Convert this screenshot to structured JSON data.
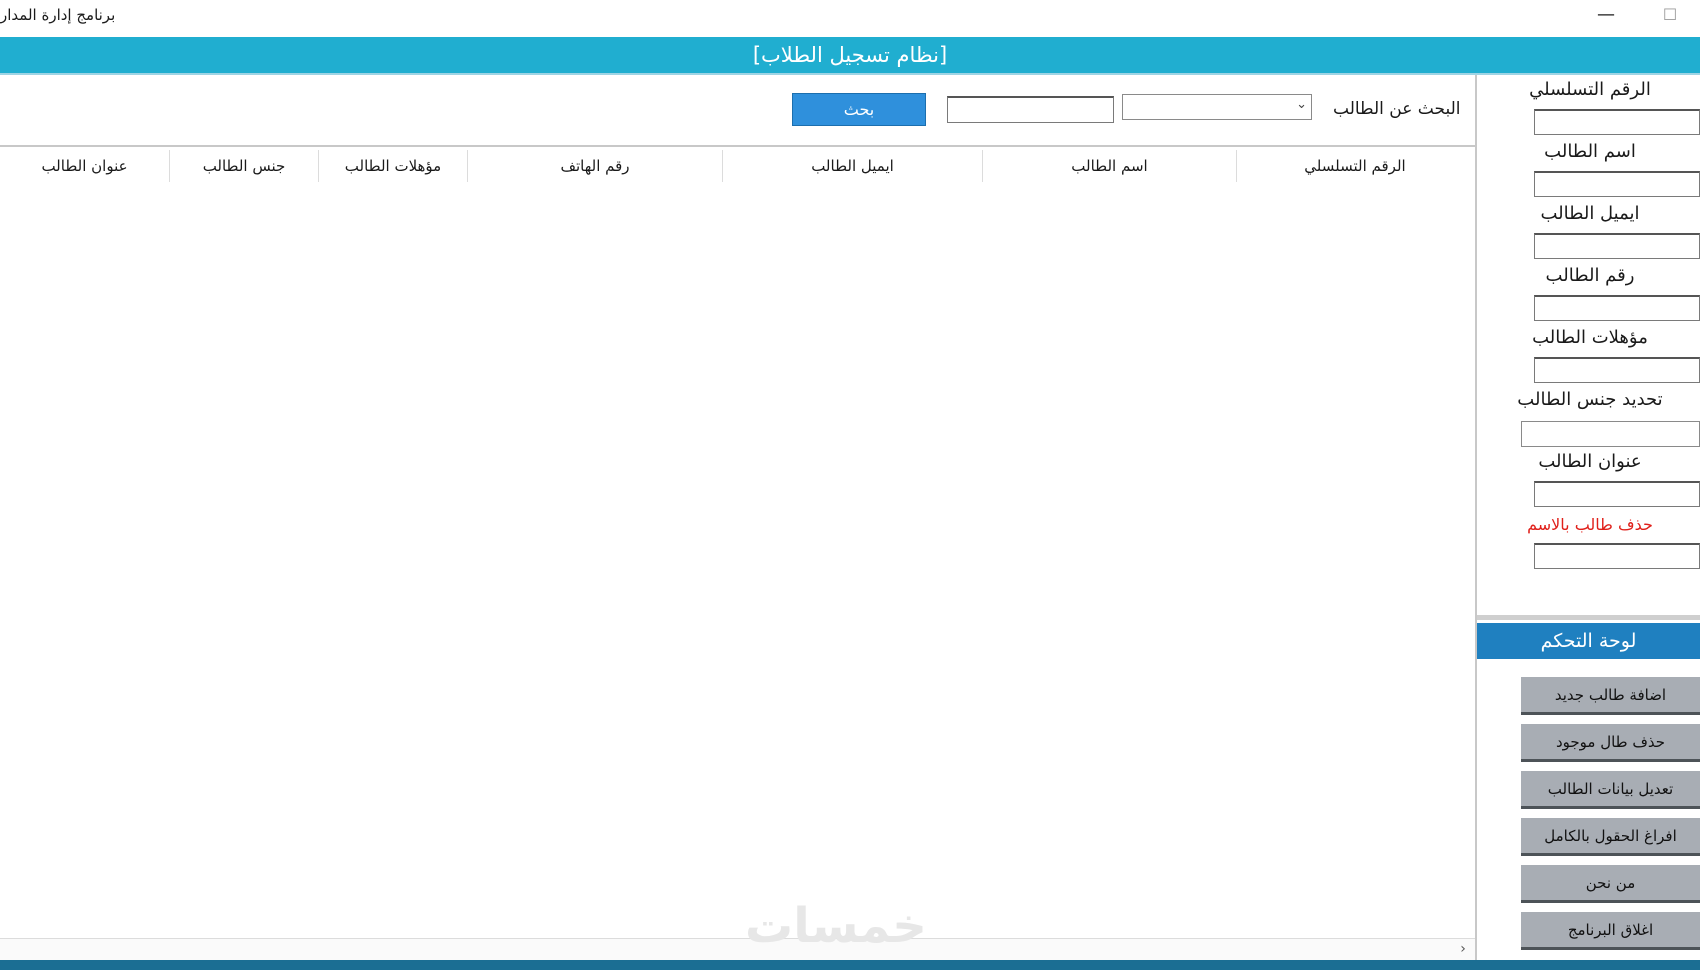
{
  "window": {
    "title": "برنامج إدارة المدار",
    "minimize": "—",
    "maximize": "☐"
  },
  "header": {
    "title": "[نظام تسجيل الطلاب]"
  },
  "search": {
    "label": "البحث عن الطالب",
    "select_value": "",
    "input_value": "",
    "button_label": "بحث"
  },
  "grid": {
    "columns": [
      "الرقم التسلسلي",
      "اسم الطالب",
      "ايميل الطالب",
      "رقم الهاتف",
      "مؤهلات الطالب",
      "جنس الطالب",
      "عنوان الطالب"
    ],
    "rows": []
  },
  "form": {
    "fields": [
      {
        "label": "الرقم التسلسلي",
        "value": ""
      },
      {
        "label": "اسم الطالب",
        "value": ""
      },
      {
        "label": "ايميل الطالب",
        "value": ""
      },
      {
        "label": "رقم الطالب",
        "value": ""
      },
      {
        "label": "مؤهلات الطالب",
        "value": ""
      },
      {
        "label": "تحديد جنس الطالب",
        "value": ""
      },
      {
        "label": "عنوان الطالب",
        "value": ""
      }
    ],
    "delete_label": "حذف طالب بالاسم",
    "delete_value": ""
  },
  "control_panel": {
    "title": "لوحة التحكم",
    "buttons": [
      "اضافة طالب جديد",
      "حذف طال موجود",
      "تعديل بيانات الطالب",
      "افراغ الحقول بالكامل",
      "من نحن",
      "اغلاق البرنامج"
    ]
  },
  "watermark": "خمسات",
  "icons": {
    "chevron": "chevron-down-icon",
    "scroll_right": "chevron-right-icon"
  },
  "colors": {
    "header": "#20aed0",
    "panel_header": "#1f80c0",
    "search_button": "#2f90dc",
    "control_button": "#a8adb4",
    "delete_label": "#e0201a"
  }
}
